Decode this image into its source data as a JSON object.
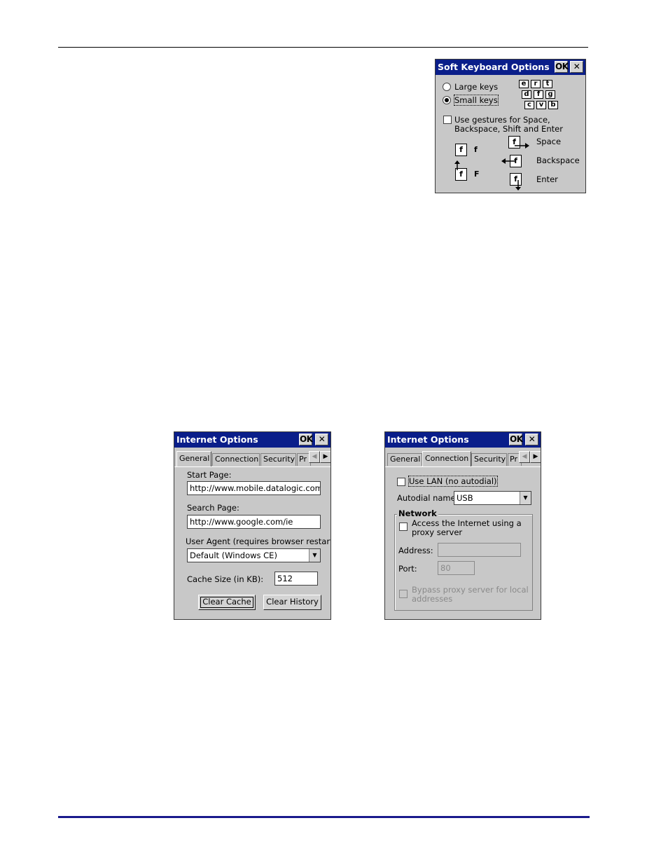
{
  "soft_keyboard": {
    "title": "Soft Keyboard Options",
    "ok": "OK",
    "close": "✕",
    "large_keys": "Large keys",
    "small_keys": "Small keys",
    "key_rows": [
      [
        "e",
        "r",
        "t"
      ],
      [
        "d",
        "f",
        "g"
      ],
      [
        "c",
        "v",
        "b"
      ]
    ],
    "use_gestures": "Use gestures for Space,",
    "use_gestures_2": "Backspace, Shift and Enter",
    "gesture_lower": "f",
    "gesture_upper": "F",
    "space": "Space",
    "backspace": "Backspace",
    "enter": "Enter",
    "glyph_f": "f"
  },
  "internet_general": {
    "title": "Internet Options",
    "ok": "OK",
    "close": "✕",
    "tabs": [
      "General",
      "Connection",
      "Security",
      "Pr"
    ],
    "start_page_label": "Start Page:",
    "start_page_value": "http://www.mobile.datalogic.com",
    "search_page_label": "Search Page:",
    "search_page_value": "http://www.google.com/ie",
    "user_agent_label": "User Agent (requires browser restart):",
    "user_agent_value": "Default (Windows CE)",
    "cache_label": "Cache Size (in KB):",
    "cache_value": "512",
    "clear_cache": "Clear Cache",
    "clear_history": "Clear History"
  },
  "internet_connection": {
    "title": "Internet Options",
    "ok": "OK",
    "close": "✕",
    "tabs": [
      "General",
      "Connection",
      "Security",
      "Pr"
    ],
    "use_lan": "Use LAN (no autodial)",
    "autodial_label": "Autodial name:",
    "autodial_value": "USB",
    "network_legend": "Network",
    "proxy_line1": "Access the Internet using a",
    "proxy_line2": "proxy server",
    "address_label": "Address:",
    "address_value": "",
    "port_label": "Port:",
    "port_value": "80",
    "bypass_line1": "Bypass proxy server for local",
    "bypass_line2": "addresses"
  }
}
